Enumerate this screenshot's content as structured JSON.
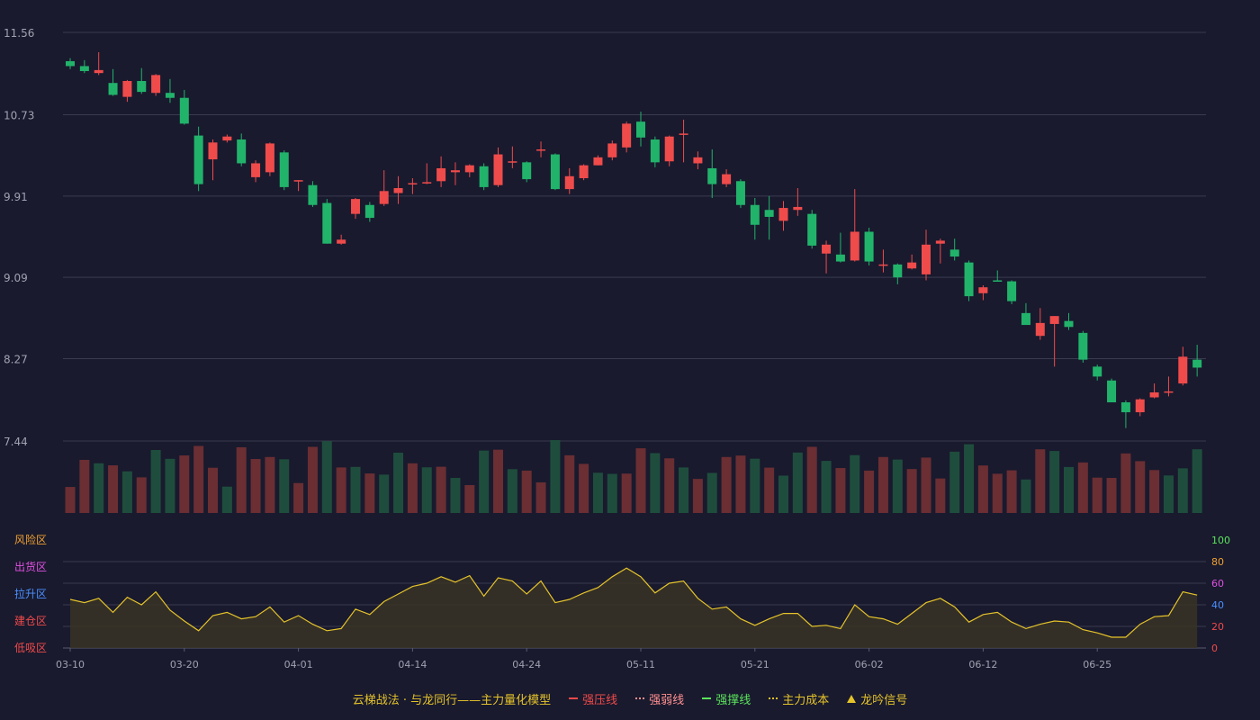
{
  "colors": {
    "background": "#191a2e",
    "up": "#ef4b4b",
    "down": "#22b36b",
    "vol_up": "#6a2e33",
    "vol_down": "#1f4d3d",
    "grid": "#3a3b50",
    "axis_text": "#a0a3b0",
    "indicator_line": "#e5c32a",
    "indicator_fill": "#3a3424",
    "green_label": "#5be35b",
    "orange_label": "#f0a030",
    "magenta_label": "#e050e0",
    "blue_label": "#4a90ff",
    "red_label": "#f04a4a"
  },
  "chart_data": [
    {
      "type": "candlestick",
      "y_ticks": [
        "11.56",
        "10.73",
        "9.91",
        "9.09",
        "8.27",
        "7.44"
      ],
      "ylim": [
        7.44,
        11.56
      ],
      "x_ticks": [
        "03-10",
        "03-20",
        "04-01",
        "04-14",
        "04-24",
        "05-11",
        "05-21",
        "06-02",
        "06-12",
        "06-25"
      ],
      "x_tick_index": [
        0,
        8,
        16,
        24,
        32,
        40,
        48,
        56,
        64,
        72
      ],
      "grid": true,
      "candles": [
        [
          11.27,
          11.22,
          11.3,
          11.19
        ],
        [
          11.22,
          11.17,
          11.28,
          11.15
        ],
        [
          11.15,
          11.18,
          11.36,
          11.13
        ],
        [
          11.05,
          10.93,
          11.19,
          10.92
        ],
        [
          10.91,
          11.07,
          11.08,
          10.86
        ],
        [
          11.07,
          10.96,
          11.2,
          10.94
        ],
        [
          10.95,
          11.13,
          11.14,
          10.92
        ],
        [
          10.95,
          10.9,
          11.09,
          10.85
        ],
        [
          10.9,
          10.64,
          10.98,
          10.63
        ],
        [
          10.52,
          10.03,
          10.61,
          9.96
        ],
        [
          10.28,
          10.45,
          10.48,
          10.07
        ],
        [
          10.47,
          10.51,
          10.53,
          10.45
        ],
        [
          10.48,
          10.24,
          10.54,
          10.21
        ],
        [
          10.1,
          10.24,
          10.27,
          10.05
        ],
        [
          10.15,
          10.44,
          10.45,
          10.11
        ],
        [
          10.35,
          10.0,
          10.37,
          9.97
        ],
        [
          10.06,
          10.07,
          10.07,
          9.96
        ],
        [
          10.02,
          9.82,
          10.06,
          9.8
        ],
        [
          9.84,
          9.43,
          9.88,
          9.43
        ],
        [
          9.43,
          9.47,
          9.52,
          9.42
        ],
        [
          9.73,
          9.88,
          9.89,
          9.68
        ],
        [
          9.82,
          9.69,
          9.85,
          9.65
        ],
        [
          9.83,
          9.96,
          10.17,
          9.81
        ],
        [
          9.94,
          9.99,
          10.11,
          9.83
        ],
        [
          10.04,
          10.04,
          10.09,
          9.93
        ],
        [
          10.04,
          10.05,
          10.24,
          10.03
        ],
        [
          10.06,
          10.19,
          10.31,
          10.0
        ],
        [
          10.15,
          10.17,
          10.25,
          10.02
        ],
        [
          10.15,
          10.22,
          10.23,
          10.1
        ],
        [
          10.21,
          10.0,
          10.24,
          9.97
        ],
        [
          10.02,
          10.33,
          10.4,
          10.0
        ],
        [
          10.25,
          10.26,
          10.41,
          10.19
        ],
        [
          10.25,
          10.08,
          10.26,
          10.05
        ],
        [
          10.37,
          10.38,
          10.46,
          10.3
        ],
        [
          10.33,
          9.98,
          10.34,
          9.97
        ],
        [
          9.98,
          10.11,
          10.19,
          9.93
        ],
        [
          10.09,
          10.22,
          10.23,
          10.07
        ],
        [
          10.22,
          10.3,
          10.32,
          10.22
        ],
        [
          10.3,
          10.44,
          10.47,
          10.27
        ],
        [
          10.4,
          10.64,
          10.66,
          10.35
        ],
        [
          10.66,
          10.5,
          10.76,
          10.41
        ],
        [
          10.48,
          10.25,
          10.51,
          10.2
        ],
        [
          10.26,
          10.51,
          10.52,
          10.21
        ],
        [
          10.53,
          10.54,
          10.68,
          10.25
        ],
        [
          10.24,
          10.3,
          10.36,
          10.18
        ],
        [
          10.19,
          10.03,
          10.38,
          9.89
        ],
        [
          10.03,
          10.13,
          10.18,
          10.0
        ],
        [
          10.06,
          9.82,
          10.08,
          9.79
        ],
        [
          9.82,
          9.62,
          9.89,
          9.47
        ],
        [
          9.77,
          9.7,
          9.91,
          9.47
        ],
        [
          9.66,
          9.79,
          9.86,
          9.56
        ],
        [
          9.77,
          9.8,
          9.99,
          9.71
        ],
        [
          9.73,
          9.41,
          9.77,
          9.38
        ],
        [
          9.33,
          9.42,
          9.46,
          9.13
        ],
        [
          9.32,
          9.25,
          9.54,
          9.24
        ],
        [
          9.26,
          9.55,
          9.98,
          9.25
        ],
        [
          9.55,
          9.25,
          9.59,
          9.21
        ],
        [
          9.22,
          9.22,
          9.37,
          9.14
        ],
        [
          9.22,
          9.09,
          9.23,
          9.02
        ],
        [
          9.18,
          9.24,
          9.32,
          9.17
        ],
        [
          9.12,
          9.42,
          9.57,
          9.06
        ],
        [
          9.43,
          9.46,
          9.48,
          9.23
        ],
        [
          9.37,
          9.3,
          9.48,
          9.26
        ],
        [
          9.24,
          8.9,
          9.26,
          8.85
        ],
        [
          8.93,
          8.99,
          9.01,
          8.86
        ],
        [
          9.06,
          9.05,
          9.16,
          9.05
        ],
        [
          9.05,
          8.85,
          9.06,
          8.82
        ],
        [
          8.73,
          8.61,
          8.83,
          8.63
        ],
        [
          8.5,
          8.63,
          8.78,
          8.46
        ],
        [
          8.62,
          8.7,
          8.7,
          8.19
        ],
        [
          8.65,
          8.59,
          8.73,
          8.56
        ],
        [
          8.53,
          8.26,
          8.55,
          8.23
        ],
        [
          8.19,
          8.09,
          8.21,
          8.05
        ],
        [
          8.05,
          7.83,
          8.07,
          7.84
        ],
        [
          7.83,
          7.73,
          7.85,
          7.57
        ],
        [
          7.73,
          7.86,
          7.87,
          7.69
        ],
        [
          7.88,
          7.93,
          8.02,
          7.87
        ],
        [
          7.93,
          7.94,
          8.09,
          7.89
        ],
        [
          8.02,
          8.29,
          8.39,
          8.0
        ],
        [
          8.26,
          8.18,
          8.41,
          8.09
        ]
      ],
      "volume_up": [
        true,
        true,
        false,
        true,
        false,
        true,
        false,
        false,
        true,
        true,
        true,
        false,
        true,
        true,
        true,
        false,
        true,
        true,
        false,
        true,
        false,
        true,
        false,
        false,
        true,
        false,
        true,
        false,
        true,
        false,
        true,
        false,
        true,
        true,
        false,
        true,
        true,
        false,
        false,
        true,
        true,
        false,
        true,
        false,
        true,
        false,
        true,
        true,
        false,
        true,
        false,
        false,
        true,
        false,
        true,
        false,
        true,
        true,
        false,
        true,
        true,
        true,
        false,
        false,
        true,
        true,
        true,
        false,
        true,
        false,
        false,
        true,
        true,
        true,
        true,
        true,
        true,
        false,
        false,
        false,
        true
      ]
    },
    {
      "type": "area",
      "y_ticks": [
        "0",
        "20",
        "40",
        "60",
        "80",
        "100"
      ],
      "ylim": [
        0,
        100
      ],
      "zone_labels": [
        "风险区",
        "出货区",
        "拉升区",
        "建仓区",
        "低吸区"
      ],
      "series_name": "主力量化模型",
      "values": [
        45,
        42,
        46,
        33,
        47,
        40,
        52,
        35,
        25,
        16,
        30,
        33,
        27,
        29,
        38,
        24,
        30,
        22,
        16,
        18,
        36,
        31,
        43,
        50,
        57,
        60,
        66,
        61,
        67,
        48,
        65,
        62,
        50,
        62,
        42,
        45,
        51,
        56,
        66,
        74,
        66,
        51,
        60,
        62,
        46,
        36,
        38,
        27,
        21,
        27,
        32,
        32,
        20,
        21,
        18,
        40,
        29,
        27,
        22,
        32,
        42,
        46,
        38,
        24,
        31,
        33,
        24,
        18,
        22,
        25,
        24,
        17,
        14,
        10,
        10,
        22,
        29,
        30,
        52,
        49
      ]
    }
  ],
  "legend": {
    "title": "云梯战法 · 与龙同行——主力量化模型",
    "items": [
      {
        "label": "强压线",
        "color": "#f04a4a",
        "style": "line"
      },
      {
        "label": "强弱线",
        "color": "#ff9090",
        "style": "dash"
      },
      {
        "label": "强撑线",
        "color": "#5be35b",
        "style": "line"
      },
      {
        "label": "主力成本",
        "color": "#e5c32a",
        "style": "dash"
      },
      {
        "label": "龙吟信号",
        "color": "#e5c32a",
        "style": "triangle"
      }
    ]
  }
}
